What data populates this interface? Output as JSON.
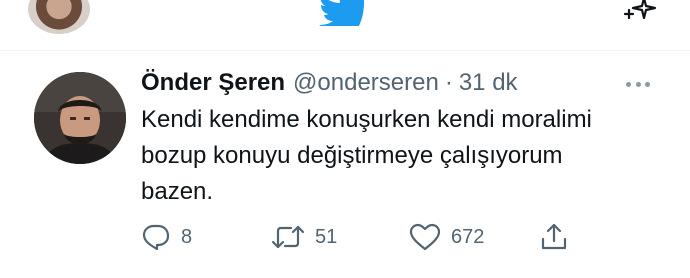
{
  "colors": {
    "brand_blue": "#1d9bf0",
    "text_primary": "#0f1419",
    "text_secondary": "#536471"
  },
  "topbar": {
    "logo_icon": "twitter-bird-icon",
    "right_icon": "sparkle-icon"
  },
  "tweet": {
    "author_name": "Önder Şeren",
    "handle": "@onderseren",
    "separator": "·",
    "time": "31 dk",
    "text_lines": [
      "Kendi kendime konuşurken kendi moralimi",
      "bozup konuyu değiştirmeye çalışıyorum",
      "bazen."
    ],
    "actions": {
      "reply": {
        "icon": "reply-icon",
        "count": "8"
      },
      "retweet": {
        "icon": "retweet-icon",
        "count": "51"
      },
      "like": {
        "icon": "heart-icon",
        "count": "672"
      },
      "share": {
        "icon": "share-icon"
      }
    },
    "more_icon": "more-options-icon"
  }
}
